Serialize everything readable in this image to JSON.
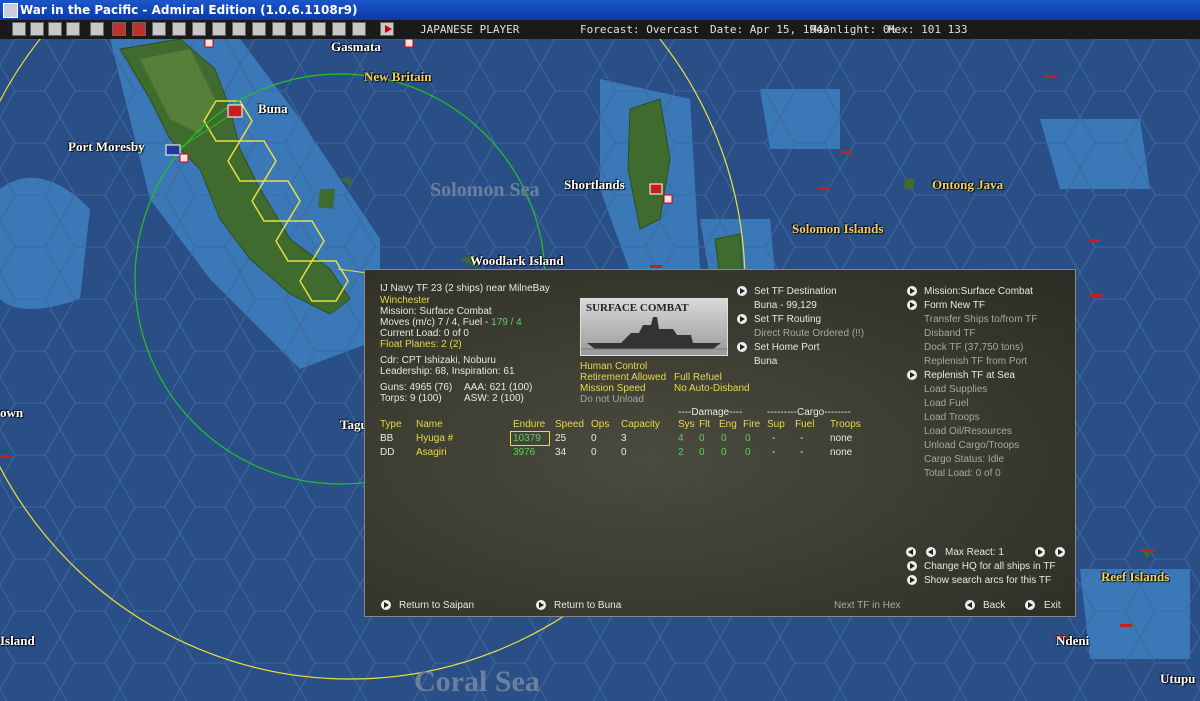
{
  "window": {
    "title": "War in the Pacific - Admiral Edition (1.0.6.1108r9)"
  },
  "toolbar": {
    "player": "JAPANESE PLAYER",
    "forecast": "Forecast: Overcast",
    "date": "Date: Apr 15, 1942",
    "moonlight": "Moonlight: 0%",
    "hex": "Hex: 101 133"
  },
  "map": {
    "places": {
      "gasmata": "Gasmata",
      "new_britain": "New Britain",
      "buna": "Buna",
      "port_moresby": "Port Moresby",
      "solomon_sea": "Solomon Sea",
      "shortlands": "Shortlands",
      "ontong_java": "Ontong Java",
      "solomon_islands": "Solomon Islands",
      "woodlark_island": "Woodlark Island",
      "town": "own",
      "tagu": "Tagu",
      "island": "Island",
      "coral_sea": "Coral Sea",
      "reef_islands": "Reef Islands",
      "ndeni": "Ndeni",
      "utupu": "Utupu"
    }
  },
  "tf": {
    "header": "IJ Navy TF 23 (2 ships) near MilneBay",
    "flagship": "Winchester",
    "mission": "Mission: Surface Combat",
    "moves": "Moves (m/c) 7 / 4, Fuel -",
    "fuel_value": "179 / 4",
    "current_load": "Current Load: 0 of 0",
    "float_planes": "Float Planes: 2 (2)",
    "commander": "Cdr: CPT Ishizaki, Noburu",
    "leadership": "Leadership: 68, Inspiration: 61",
    "guns": "Guns: 4965 (76)",
    "aaa": "AAA: 621 (100)",
    "torps": "Torps: 9 (100)",
    "asw": "ASW: 2 (100)",
    "photo_label": "SURFACE COMBAT",
    "human_control": "Human Control",
    "retirement": "Retirement Allowed",
    "full_refuel": "Full Refuel",
    "mission_speed": "Mission Speed",
    "no_auto_disband": "No Auto-Disband",
    "do_not_unload": "Do not Unload"
  },
  "nav": {
    "set_destination": "Set TF Destination",
    "destination_value": "Buna - 99,129",
    "set_routing": "Set TF Routing",
    "routing_value": "Direct Route Ordered (!!)",
    "set_home_port": "Set Home Port",
    "home_port_value": "Buna"
  },
  "actions": {
    "mission_surface_combat": "Mission:Surface Combat",
    "form_new_tf": "Form New TF",
    "transfer_ships": "Transfer Ships to/from TF",
    "disband_tf": "Disband TF",
    "dock_tf": "Dock TF (37,750 tons)",
    "replenish_port": "Replenish TF from Port",
    "replenish_sea": "Replenish TF at Sea",
    "load_supplies": "Load Supplies",
    "load_fuel": "Load Fuel",
    "load_troops": "Load Troops",
    "load_oil": "Load Oil/Resources",
    "unload_cargo": "Unload Cargo/Troops",
    "cargo_status": "Cargo Status: Idle",
    "total_load": "Total Load: 0 of 0"
  },
  "table": {
    "group_damage": "----Damage----",
    "group_cargo": "---------Cargo--------",
    "headers": [
      "Type",
      "Name",
      "Endure",
      "Speed",
      "Ops",
      "Capacity",
      "Sys",
      "Flt",
      "Eng",
      "Fire",
      "Sup",
      "Fuel",
      "Troops"
    ],
    "rows": [
      [
        "BB",
        "Hyuga #",
        "10379",
        "25",
        "0",
        "3",
        "4",
        "0",
        "0",
        "0",
        "-",
        "-",
        "none"
      ],
      [
        "DD",
        "Asagiri",
        "3976",
        "34",
        "0",
        "0",
        "2",
        "0",
        "0",
        "0",
        "-",
        "-",
        "none"
      ]
    ]
  },
  "react": {
    "max_react": "Max React: 1",
    "change_hq": "Change HQ for all ships in TF",
    "show_arcs": "Show search arcs for this TF"
  },
  "footer": {
    "return_saipan": "Return to Saipan",
    "return_buna": "Return to Buna",
    "next_tf": "Next TF in Hex",
    "back": "Back",
    "exit": "Exit"
  },
  "colors": {
    "yellow": "#e8d84a",
    "green": "#5fd05f",
    "ocean": "#2a4f86"
  }
}
